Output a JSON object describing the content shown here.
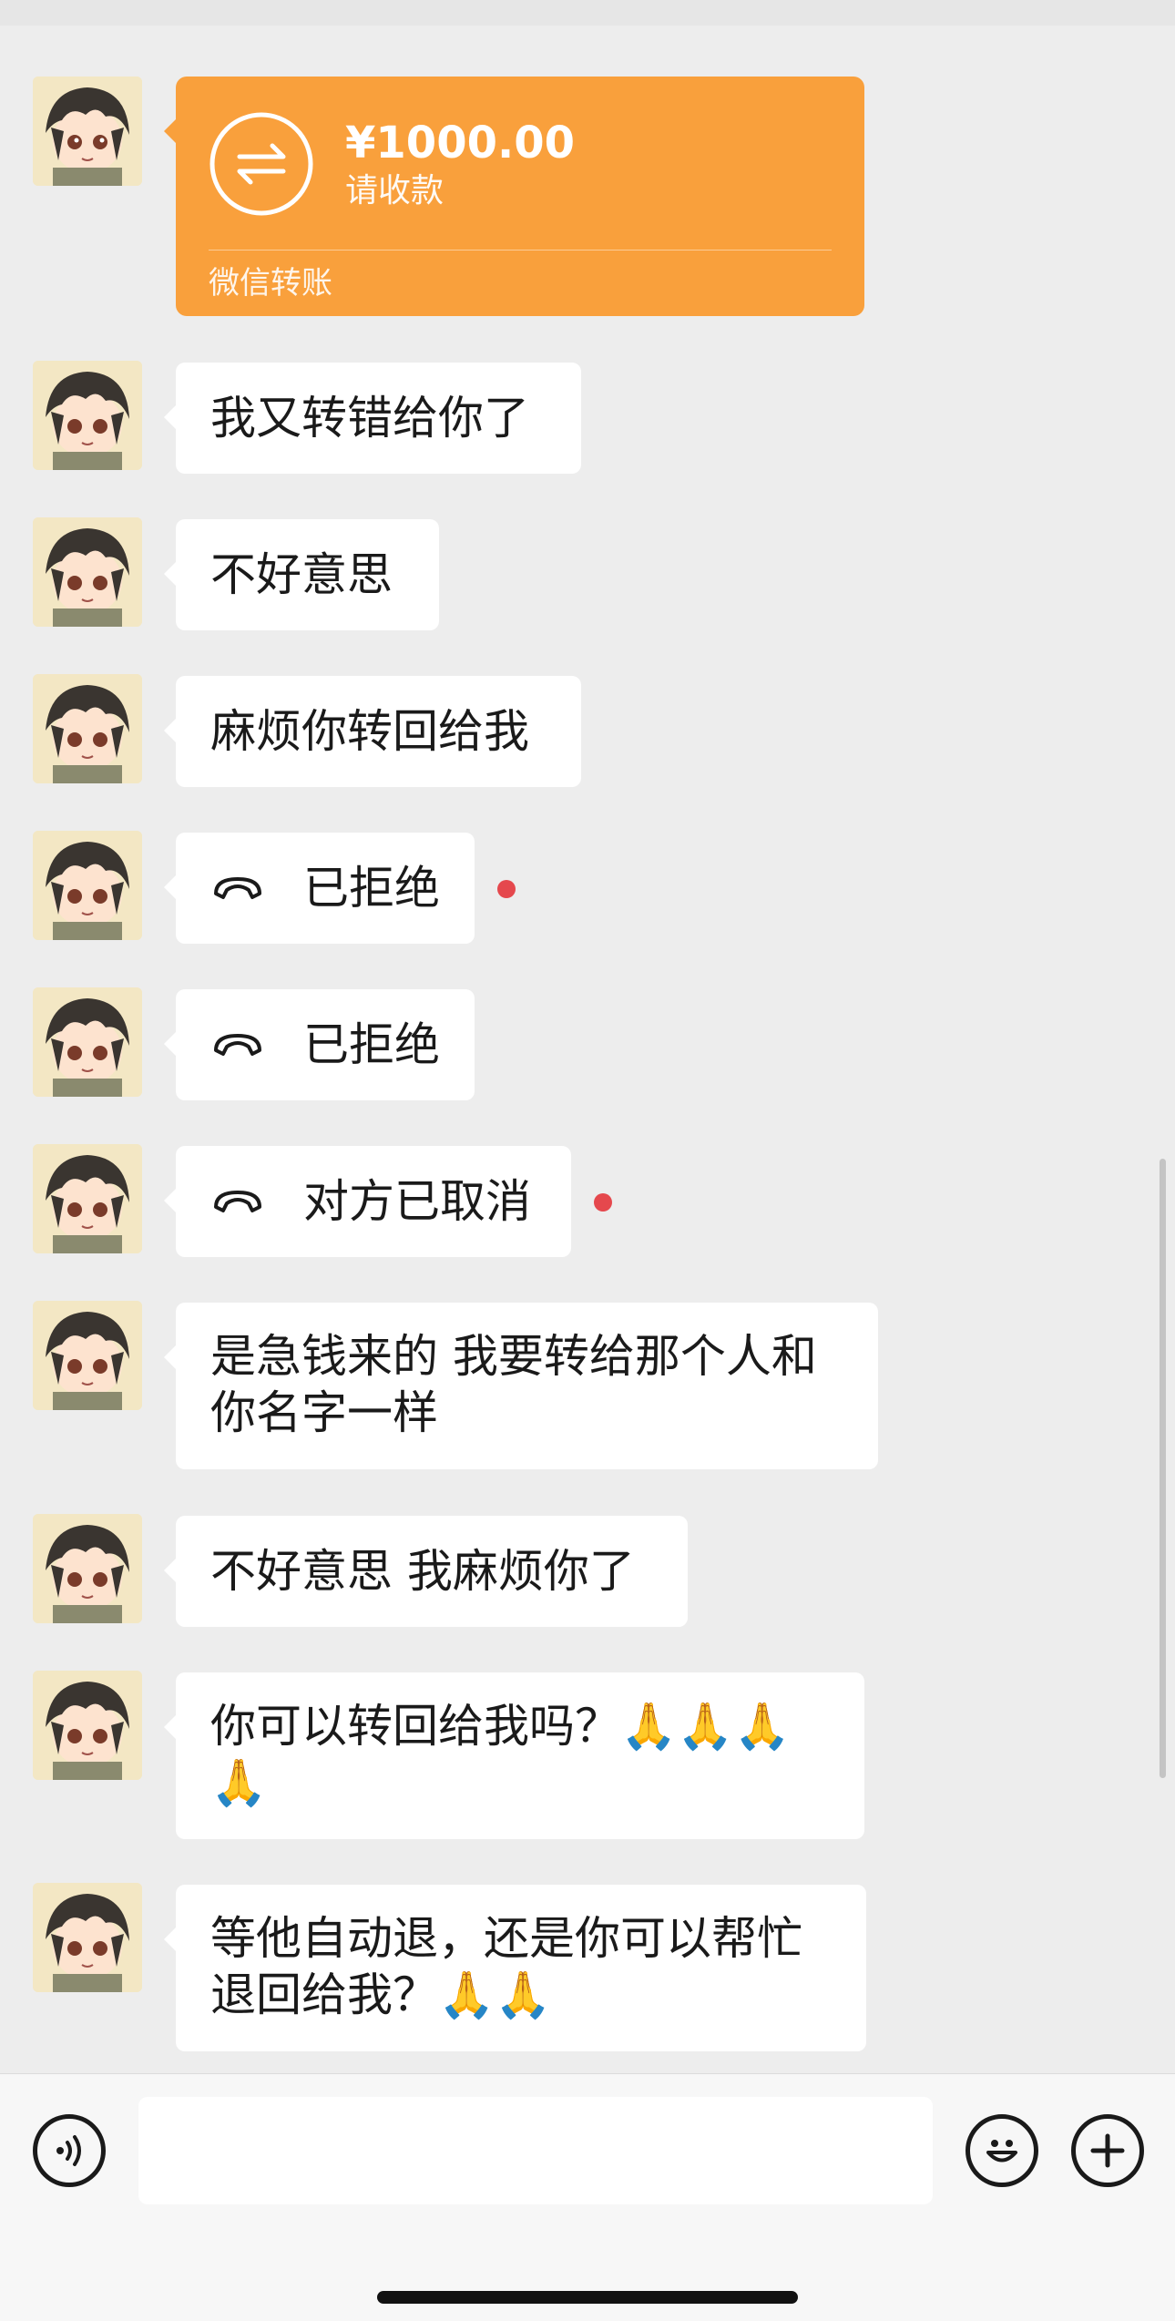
{
  "transfer": {
    "amount": "¥1000.00",
    "status": "请收款",
    "brand": "微信转账",
    "icon": "transfer-arrows-icon"
  },
  "messages": [
    {
      "type": "text",
      "text": "我又转错给你了"
    },
    {
      "type": "text",
      "text": "不好意思"
    },
    {
      "type": "text",
      "text": "麻烦你转回给我"
    },
    {
      "type": "call",
      "text": "已拒绝",
      "icon": "hangup-phone-icon",
      "unread": true
    },
    {
      "type": "call",
      "text": "已拒绝",
      "icon": "hangup-phone-icon",
      "unread": false
    },
    {
      "type": "call",
      "text": "对方已取消",
      "icon": "hangup-phone-icon",
      "unread": true
    },
    {
      "type": "text",
      "lines": [
        "是急钱来的 我要转给那个人和",
        "你名字一样"
      ]
    },
    {
      "type": "text",
      "text": "不好意思 我麻烦你了"
    },
    {
      "type": "text",
      "lines": [
        "你可以转回给我吗？🙏🙏🙏",
        "🙏"
      ]
    },
    {
      "type": "text",
      "lines": [
        "等他自动退，还是你可以帮忙",
        "退回给我？🙏🙏"
      ]
    }
  ],
  "colors": {
    "background": "#ededed",
    "bubble": "#ffffff",
    "transfer": "#f9a03c",
    "unread_dot": "#e5484d"
  },
  "input_bar": {
    "voice_icon": "voice-icon",
    "emoji_icon": "emoji-icon",
    "plus_icon": "plus-icon",
    "placeholder": ""
  }
}
